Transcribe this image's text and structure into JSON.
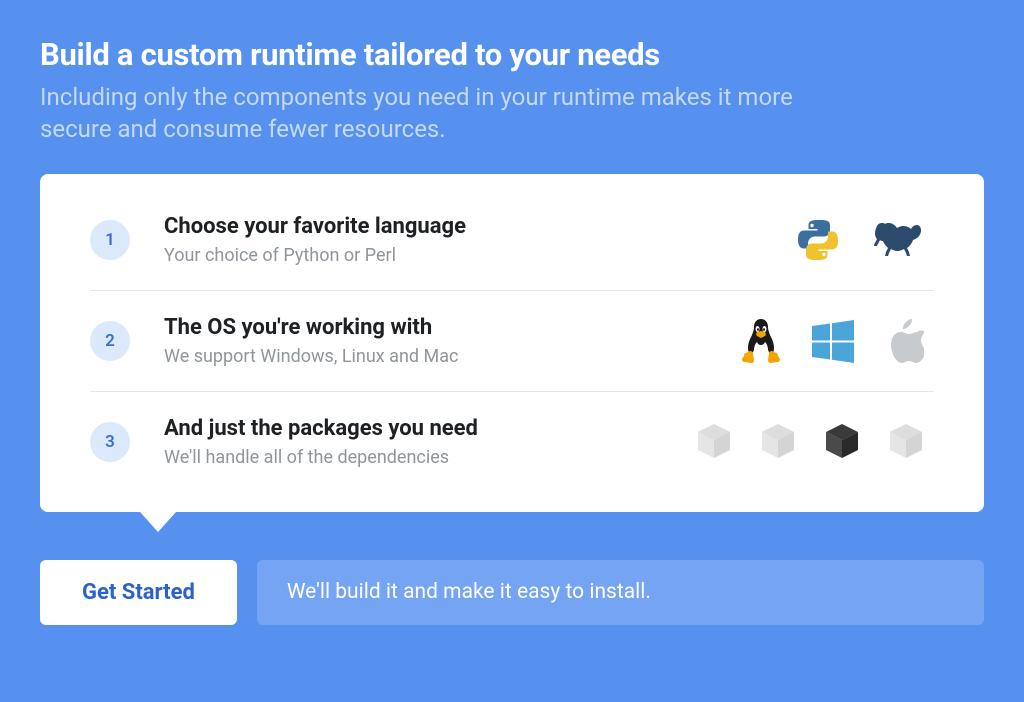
{
  "header": {
    "title": "Build a custom runtime tailored to your needs",
    "subtitle": "Including only the components you need in your runtime makes it more secure and consume fewer resources."
  },
  "steps": [
    {
      "number": "1",
      "title": "Choose your favorite language",
      "description": "Your choice of Python or Perl"
    },
    {
      "number": "2",
      "title": "The OS you're working with",
      "description": "We support Windows, Linux and Mac"
    },
    {
      "number": "3",
      "title": "And just the packages you need",
      "description": "We'll handle all of the dependencies"
    }
  ],
  "actions": {
    "get_started": "Get Started",
    "info": "We'll build it and make it easy to install."
  }
}
